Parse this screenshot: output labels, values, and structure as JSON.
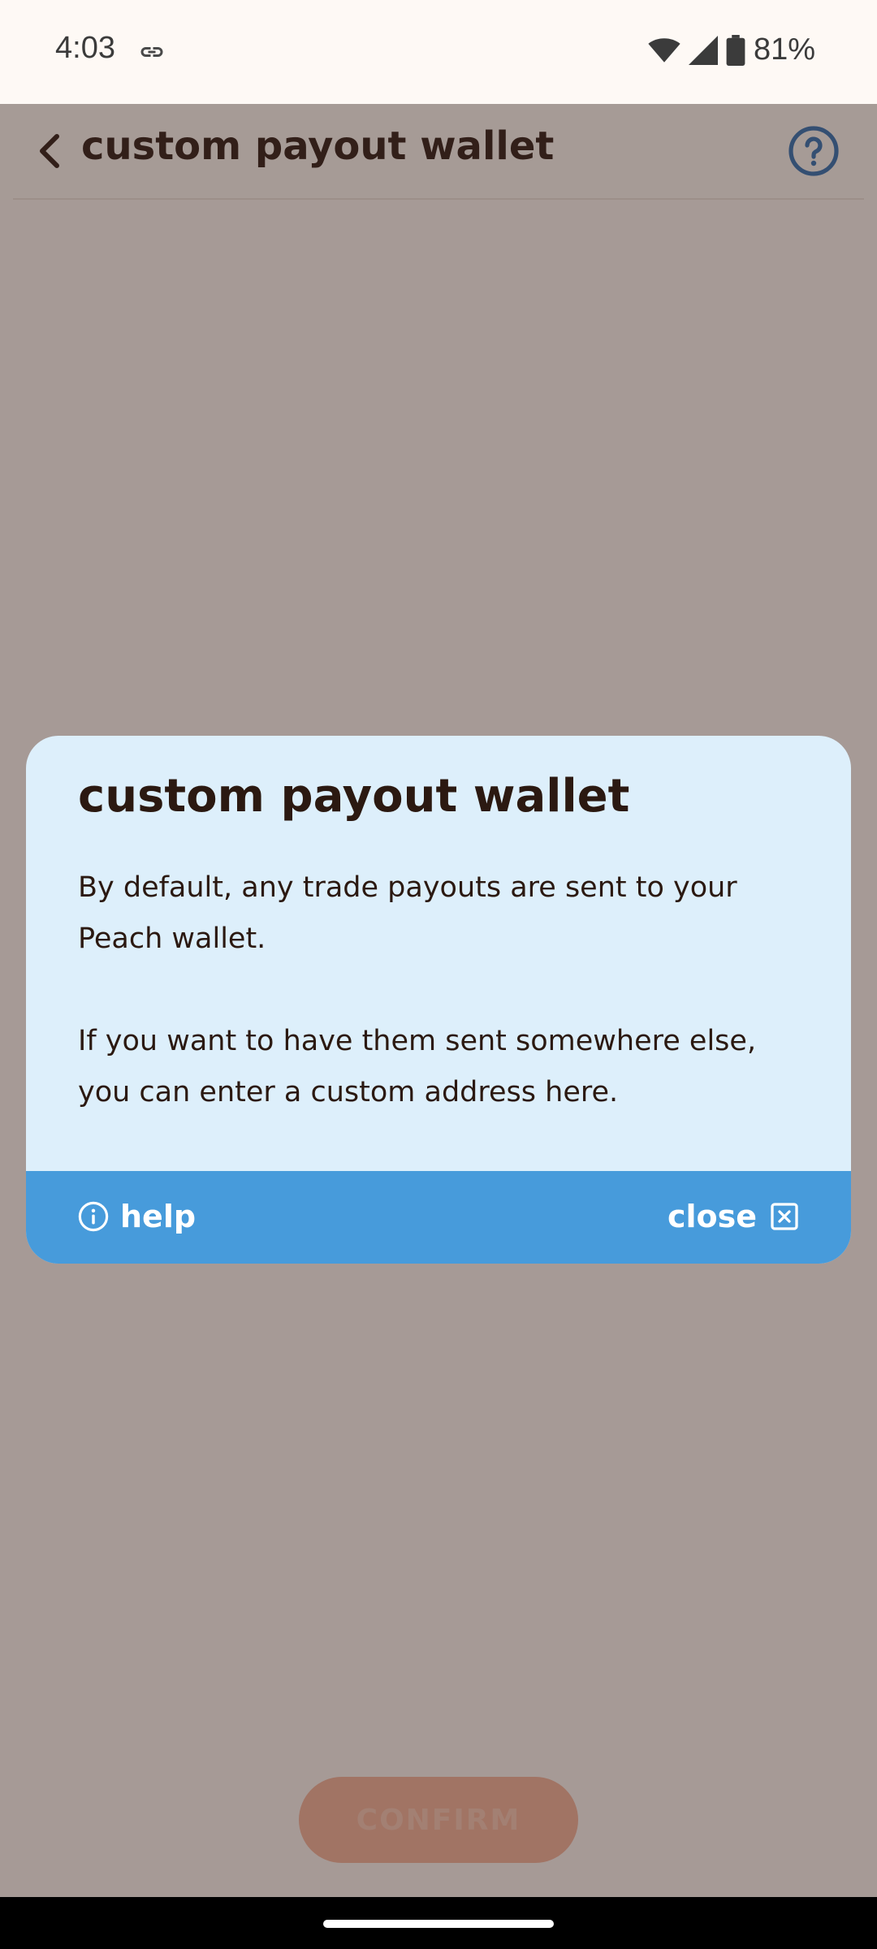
{
  "status_bar": {
    "time": "4:03",
    "battery_percent": "81%",
    "icons": [
      "link-icon",
      "wifi-icon",
      "signal-icon",
      "battery-icon"
    ]
  },
  "header": {
    "title": "custom payout wallet",
    "back_icon": "chevron-left-icon",
    "help_icon": "question-circle-icon"
  },
  "main": {
    "confirm_label": "CONFIRM"
  },
  "modal": {
    "title": "custom payout wallet",
    "paragraphs": [
      "By default, any trade payouts are sent to your Peach wallet.",
      "If you want to have them sent somewhere else, you can enter a custom address here."
    ],
    "help_label": "help",
    "close_label": "close",
    "help_icon": "info-circle-icon",
    "close_icon": "close-box-icon"
  },
  "colors": {
    "background": "#fef9f5",
    "text": "#2b1911",
    "modal_background": "#ddeffb",
    "modal_footer": "#479bdb",
    "help_icon": "#2f6fb3",
    "confirm_button": "#f4b29a"
  }
}
